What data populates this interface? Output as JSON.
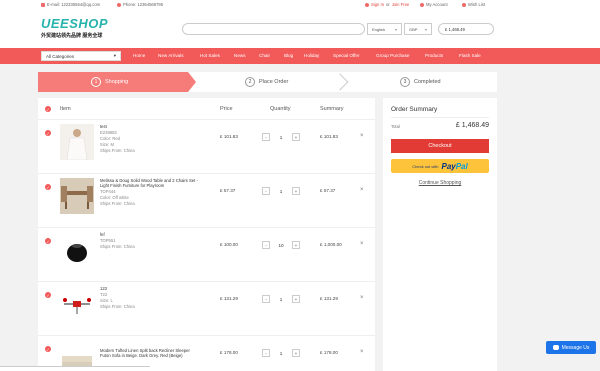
{
  "topbar": {
    "email": "E-mail: 122335564@qq.com",
    "phone": "Phone: 12364568795",
    "sign_in": "Sign In",
    "or": " or ",
    "join": "Join Free",
    "my_account": "My Account",
    "wish_list": "Wish List"
  },
  "header": {
    "logo": "UEESHOP",
    "logo_sub": "外贸建站领先品牌 服务全球",
    "language": "English",
    "currency": "GBP",
    "cart_total": "£ 1,468.49"
  },
  "nav": {
    "all_categories": "All Categories",
    "links": [
      "Home",
      "New Arrivals",
      "Hot Sales",
      "News",
      "Chair",
      "Blog",
      "Holiday",
      "Special Offer",
      "Group Purchase",
      "Products",
      "Flash Sale"
    ]
  },
  "steps": [
    {
      "num": "1",
      "label": "Shopping"
    },
    {
      "num": "2",
      "label": "Place Order"
    },
    {
      "num": "3",
      "label": "Completed"
    }
  ],
  "cart": {
    "headers": {
      "item": "Item",
      "price": "Price",
      "quantity": "Quantity",
      "summary": "Summary"
    },
    "rows": [
      {
        "name": "test",
        "sku": "E239883",
        "meta1": "Color: Red",
        "meta2": "Size: M",
        "meta3": "Ships From: China",
        "price": "£ 101.83",
        "qty": "1",
        "summary": "£ 101.83"
      },
      {
        "name": "Melissa & Doug Solid Wood Table and 2 Chairs Set - Light Finish Furniture for Playroom",
        "sku": "TOP444",
        "meta1": "Color: Off white",
        "meta2": "Ships From: China",
        "meta3": "",
        "price": "£ 57.37",
        "qty": "1",
        "summary": "£ 57.37"
      },
      {
        "name": "fef",
        "sku": "TOP551",
        "meta1": "Ships From: China",
        "meta2": "",
        "meta3": "",
        "price": "£ 100.00",
        "qty": "10",
        "summary": "£ 1,000.00"
      },
      {
        "name": "123",
        "sku": "T22",
        "meta1": "Size: L",
        "meta2": "Ships From: China",
        "meta3": "",
        "price": "£ 131.29",
        "qty": "1",
        "summary": "£ 131.29"
      },
      {
        "name": "Modern Tufted Linen Split back Recliner Sleeper Futon Sofa in Beige. Dark Grey. Red (Beige)",
        "sku": "",
        "meta1": "",
        "meta2": "",
        "meta3": "",
        "price": "£ 178.00",
        "qty": "1",
        "summary": "£ 178.00"
      }
    ]
  },
  "summary": {
    "title": "Order Summary",
    "total_label": "Total",
    "total_value": "£ 1,468.49",
    "checkout": "Checkout",
    "paypal_prefix": "Check out with",
    "paypal_a": "Pay",
    "paypal_b": "Pal",
    "continue": "Continue Shopping"
  },
  "chat": {
    "label": "Message Us"
  }
}
